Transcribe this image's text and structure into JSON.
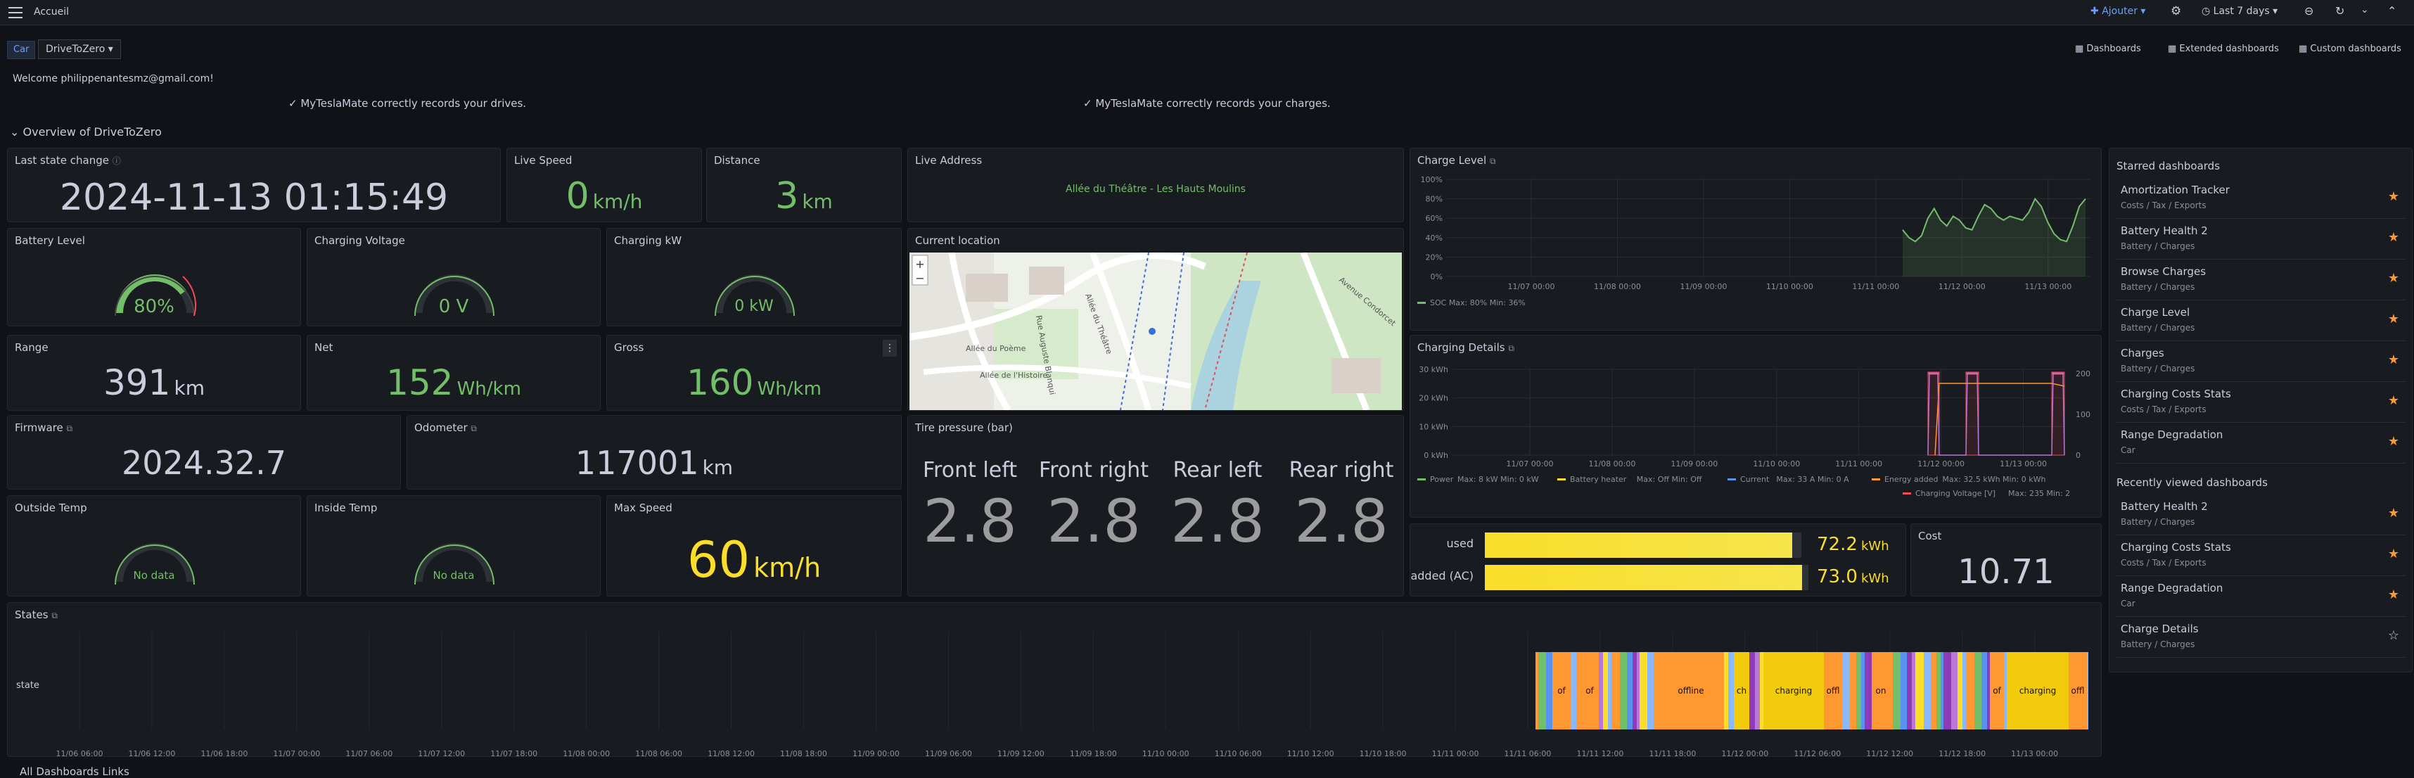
{
  "topbar": {
    "breadcrumb": "Accueil",
    "add_label": "Ajouter",
    "time_range": "Last 7 days"
  },
  "vars": {
    "car_label": "Car",
    "car_value": "DriveToZero"
  },
  "links": {
    "dashboards": "Dashboards",
    "extended": "Extended dashboards",
    "custom": "Custom dashboards"
  },
  "welcome": "Welcome philippenantesmz@gmail.com!",
  "status_drives": "✓ MyTeslaMate correctly records your drives.",
  "status_charges": "✓ MyTeslaMate correctly records your charges.",
  "row_title": "Overview of DriveToZero",
  "panels": {
    "last_state": {
      "title": "Last state change",
      "value": "2024-11-13 01:15:49"
    },
    "live_speed": {
      "title": "Live Speed",
      "value": "0",
      "unit": "km/h"
    },
    "distance": {
      "title": "Distance",
      "value": "3",
      "unit": "km"
    },
    "live_address": {
      "title": "Live Address",
      "value": "Allée du Théâtre - Les Hauts Moulins"
    },
    "battery_level": {
      "title": "Battery Level",
      "value": "80%",
      "level": 0.8
    },
    "charging_voltage": {
      "title": "Charging Voltage",
      "value": "0 V",
      "level": 0
    },
    "charging_kw": {
      "title": "Charging kW",
      "value": "0 kW",
      "level": 0
    },
    "current_location": {
      "title": "Current location"
    },
    "range": {
      "title": "Range",
      "value": "391",
      "unit": "km"
    },
    "net": {
      "title": "Net",
      "value": "152",
      "unit": "Wh/km"
    },
    "gross": {
      "title": "Gross",
      "value": "160",
      "unit": "Wh/km"
    },
    "firmware": {
      "title": "Firmware",
      "value": "2024.32.7"
    },
    "odometer": {
      "title": "Odometer",
      "value": "117001",
      "unit": "km"
    },
    "outside_temp": {
      "title": "Outside Temp",
      "value": "No data"
    },
    "inside_temp": {
      "title": "Inside Temp",
      "value": "No data"
    },
    "max_speed": {
      "title": "Max Speed",
      "value": "60",
      "unit": "km/h"
    },
    "tire": {
      "title": "Tire pressure (bar)",
      "labels": [
        "Front left",
        "Front right",
        "Rear left",
        "Rear right"
      ],
      "values": [
        "2.8",
        "2.8",
        "2.8",
        "2.8"
      ]
    },
    "charge_level": {
      "title": "Charge Level",
      "legend": "SOC  Max: 80%  Min: 36%"
    },
    "charging_details": {
      "title": "Charging Details"
    },
    "energy": {
      "used_label": "used",
      "used_value": "72.2",
      "added_label": "added (AC)",
      "added_value": "73.0",
      "unit": "kWh",
      "used_fill": 0.97,
      "added_fill": 0.98
    },
    "cost": {
      "title": "Cost",
      "value": "10.71"
    },
    "states": {
      "title": "States",
      "row_label": "state"
    }
  },
  "map": {
    "street1": "Allée de l'Histoire",
    "street2": "Allée du Poème",
    "street3": "Allée du Théâtre",
    "street4": "Avenue Condorcet",
    "street5": "Rue Auguste Blanqui"
  },
  "charge_level_chart": {
    "type": "line",
    "y_ticks": [
      "100%",
      "80%",
      "60%",
      "40%",
      "20%",
      "0%"
    ],
    "x_ticks": [
      "11/07 00:00",
      "11/08 00:00",
      "11/09 00:00",
      "11/10 00:00",
      "11/11 00:00",
      "11/12 00:00",
      "11/13 00:00"
    ],
    "series": [
      {
        "name": "SOC",
        "values": [
          48,
          40,
          36,
          42,
          60,
          70,
          58,
          52,
          62,
          58,
          50,
          48,
          62,
          74,
          70,
          62,
          58,
          62,
          60,
          58,
          66,
          80,
          72,
          56,
          44,
          38,
          36,
          52,
          72,
          80
        ]
      }
    ],
    "color": "#73bf69"
  },
  "charging_details_chart": {
    "type": "line",
    "y_ticks": [
      "30 kWh",
      "20 kWh",
      "10 kWh",
      "0 kWh"
    ],
    "y2_ticks": [
      "200",
      "100",
      "0"
    ],
    "x_ticks": [
      "11/07 00:00",
      "11/08 00:00",
      "11/09 00:00",
      "11/10 00:00",
      "11/11 00:00",
      "11/12 00:00",
      "11/13 00:00"
    ],
    "legend": [
      {
        "name": "Power",
        "stats": "Max: 8 kW  Min: 0 kW",
        "color": "#73bf69"
      },
      {
        "name": "Battery heater",
        "stats": "Max: Off  Min: Off",
        "color": "#fade2a"
      },
      {
        "name": "Current",
        "stats": "Max: 33 A  Min: 0 A",
        "color": "#5794f2"
      },
      {
        "name": "Energy added",
        "stats": "Max: 32.5 kWh  Min: 0 kWh",
        "color": "#ff9830"
      },
      {
        "name": "Charging Voltage [V]",
        "stats": "Max: 235  Min: 2",
        "color": "#f2495c"
      }
    ]
  },
  "states_chart": {
    "x_ticks": [
      "11/06 06:00",
      "11/06 12:00",
      "11/06 18:00",
      "11/07 00:00",
      "11/07 06:00",
      "11/07 12:00",
      "11/07 18:00",
      "11/08 00:00",
      "11/08 06:00",
      "11/08 12:00",
      "11/08 18:00",
      "11/09 00:00",
      "11/09 06:00",
      "11/09 12:00",
      "11/09 18:00",
      "11/10 00:00",
      "11/10 06:00",
      "11/10 12:00",
      "11/10 18:00",
      "11/11 00:00",
      "11/11 06:00",
      "11/11 12:00",
      "11/11 18:00",
      "11/12 00:00",
      "11/12 06:00",
      "11/12 12:00",
      "11/12 18:00",
      "11/13 00:00"
    ],
    "segment_labels": [
      "of",
      "of",
      "offline",
      "ch",
      "charging",
      "offl",
      "on",
      "of",
      "charging",
      "offl"
    ]
  },
  "sidebar": {
    "starred_title": "Starred dashboards",
    "starred": [
      {
        "name": "Amortization Tracker",
        "sub": "Costs / Tax / Exports"
      },
      {
        "name": "Battery Health 2",
        "sub": "Battery / Charges"
      },
      {
        "name": "Browse Charges",
        "sub": "Battery / Charges"
      },
      {
        "name": "Charge Level",
        "sub": "Battery / Charges"
      },
      {
        "name": "Charges",
        "sub": "Battery / Charges"
      },
      {
        "name": "Charging Costs Stats",
        "sub": "Costs / Tax / Exports"
      },
      {
        "name": "Range Degradation",
        "sub": "Car"
      }
    ],
    "recent_title": "Recently viewed dashboards",
    "recent": [
      {
        "name": "Battery Health 2",
        "sub": "Battery / Charges"
      },
      {
        "name": "Charging Costs Stats",
        "sub": "Costs / Tax / Exports"
      },
      {
        "name": "Range Degradation",
        "sub": "Car"
      },
      {
        "name": "Charge Details",
        "sub": "Battery / Charges"
      }
    ]
  },
  "footer_row": "All Dashboards Links",
  "colors": {
    "accent": "#73bf69",
    "yellow": "#fade2a",
    "star": "#ff9830"
  }
}
